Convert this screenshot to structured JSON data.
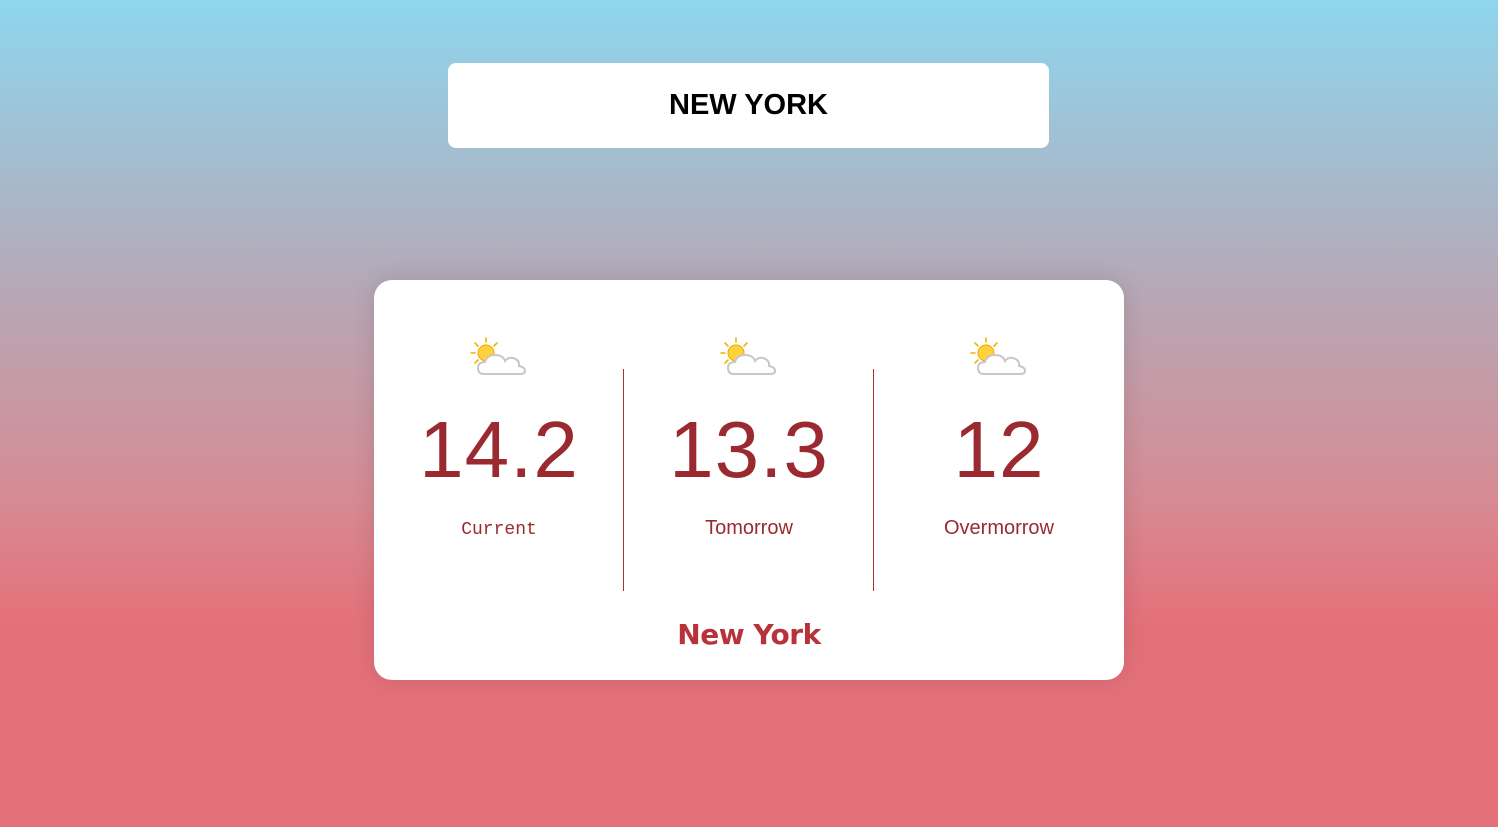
{
  "search": {
    "value": "NEW YORK",
    "placeholder": ""
  },
  "forecast": [
    {
      "icon": "partly-cloudy-icon",
      "temperature": "14.2",
      "label": "Current"
    },
    {
      "icon": "partly-cloudy-icon",
      "temperature": "13.3",
      "label": "Tomorrow"
    },
    {
      "icon": "partly-cloudy-icon",
      "temperature": "12",
      "label": "Overmorrow"
    }
  ],
  "location": {
    "city": "New York"
  },
  "colors": {
    "accent": "#9a2a30",
    "city": "#b8323a",
    "background_top": "#8ed6ee",
    "background_bottom": "#e4717a"
  }
}
